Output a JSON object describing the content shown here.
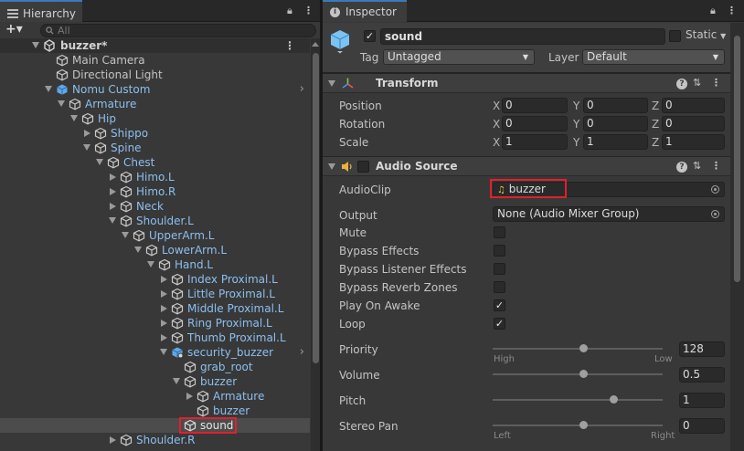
{
  "hierarchy": {
    "tab_title": "Hierarchy",
    "add_label": "+▾",
    "search_placeholder": "All",
    "scene_name": "buzzer*",
    "items": [
      {
        "label": "Main Camera",
        "kind": "plain"
      },
      {
        "label": "Directional Light",
        "kind": "plain"
      },
      {
        "label": "Nomu Custom",
        "kind": "prefab"
      },
      {
        "label": "Armature",
        "kind": "prefab"
      },
      {
        "label": "Hip",
        "kind": "prefab"
      },
      {
        "label": "Shippo",
        "kind": "prefab"
      },
      {
        "label": "Spine",
        "kind": "prefab"
      },
      {
        "label": "Chest",
        "kind": "prefab"
      },
      {
        "label": "Himo.L",
        "kind": "prefab"
      },
      {
        "label": "Himo.R",
        "kind": "prefab"
      },
      {
        "label": "Neck",
        "kind": "prefab"
      },
      {
        "label": "Shoulder.L",
        "kind": "prefab"
      },
      {
        "label": "UpperArm.L",
        "kind": "prefab"
      },
      {
        "label": "LowerArm.L",
        "kind": "prefab"
      },
      {
        "label": "Hand.L",
        "kind": "prefab"
      },
      {
        "label": "Index Proximal.L",
        "kind": "prefab"
      },
      {
        "label": "Little Proximal.L",
        "kind": "prefab"
      },
      {
        "label": "Middle Proximal.L",
        "kind": "prefab"
      },
      {
        "label": "Ring Proximal.L",
        "kind": "prefab"
      },
      {
        "label": "Thumb Proximal.L",
        "kind": "prefab"
      },
      {
        "label": "security_buzzer",
        "kind": "prefab"
      },
      {
        "label": "grab_root",
        "kind": "prefab"
      },
      {
        "label": "buzzer",
        "kind": "prefab"
      },
      {
        "label": "Armature",
        "kind": "prefab"
      },
      {
        "label": "buzzer",
        "kind": "prefab"
      },
      {
        "label": "sound",
        "kind": "plain"
      },
      {
        "label": "Shoulder.R",
        "kind": "prefab"
      }
    ]
  },
  "inspector": {
    "tab_title": "Inspector",
    "object_name": "sound",
    "static_label": "Static",
    "tag_label": "Tag",
    "tag_value": "Untagged",
    "layer_label": "Layer",
    "layer_value": "Default",
    "transform": {
      "title": "Transform",
      "position_label": "Position",
      "rotation_label": "Rotation",
      "scale_label": "Scale",
      "axis_x": "X",
      "axis_y": "Y",
      "axis_z": "Z",
      "position": [
        "0",
        "0",
        "0"
      ],
      "rotation": [
        "0",
        "0",
        "0"
      ],
      "scale": [
        "1",
        "1",
        "1"
      ]
    },
    "audio": {
      "title": "Audio Source",
      "audioclip_label": "AudioClip",
      "audioclip_value": "buzzer",
      "output_label": "Output",
      "output_value": "None (Audio Mixer Group)",
      "mute_label": "Mute",
      "bypass_effects_label": "Bypass Effects",
      "bypass_listener_label": "Bypass Listener Effects",
      "bypass_reverb_label": "Bypass Reverb Zones",
      "play_on_awake_label": "Play On Awake",
      "loop_label": "Loop",
      "priority_label": "Priority",
      "priority_value": "128",
      "priority_high": "High",
      "priority_low": "Low",
      "volume_label": "Volume",
      "volume_value": "0.5",
      "pitch_label": "Pitch",
      "pitch_value": "1",
      "stereo_label": "Stereo Pan",
      "stereo_value": "0",
      "stereo_left": "Left",
      "stereo_right": "Right"
    }
  },
  "colors": {
    "prefab_text": "#8cbff0",
    "highlight_box": "#e0202e",
    "accent_tab": "#3a79bb"
  }
}
